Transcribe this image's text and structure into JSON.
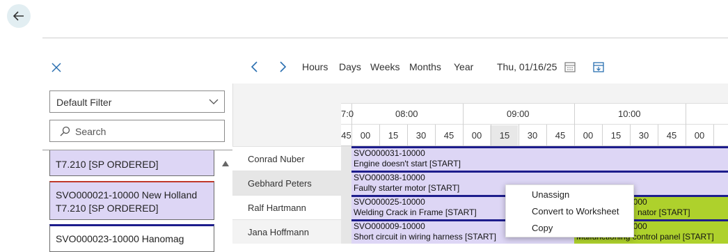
{
  "toolbar": {
    "nav": [
      "Hours",
      "Days",
      "Weeks",
      "Months",
      "Year"
    ],
    "date": "Thu, 01/16/25"
  },
  "filter": {
    "value": "Default Filter"
  },
  "search": {
    "placeholder": "Search"
  },
  "cards": [
    {
      "line1": "T7.210 [SP ORDERED]"
    },
    {
      "line1": "SVO000021-10000 New Holland",
      "line2": "T7.210 [SP ORDERED]"
    },
    {
      "line1": "SVO000023-10000 Hanomag"
    }
  ],
  "resources": [
    "Conrad Nuber",
    "Gebhard Peters",
    "Ralf Hartmann",
    "Jana Hoffmann"
  ],
  "timeline": {
    "partial_hour": "7:0",
    "partial_min": "45",
    "hours": [
      "08:00",
      "09:00",
      "10:00"
    ],
    "minutes": [
      "00",
      "15",
      "30",
      "45",
      "00",
      "15",
      "30",
      "45",
      "00",
      "15",
      "30",
      "45",
      "00"
    ]
  },
  "bars": [
    {
      "id": "SVO000031-10000",
      "desc": "Engine doesn't start [START]"
    },
    {
      "id": "SVO000038-10000",
      "desc": "Faulty starter motor [START]"
    },
    {
      "id": "SVO000025-10000",
      "desc": "Welding Crack in Frame [START]"
    },
    {
      "id": "SVO000009-10000",
      "desc": "Short circuit in wiring harness [START]"
    }
  ],
  "bars_green": [
    {
      "id": "0000",
      "desc": "nator [START]"
    },
    {
      "id": "0000",
      "desc": "Malfunctioning control panel [START]"
    }
  ],
  "context_menu": [
    "Unassign",
    "Convert to Worksheet",
    "Copy"
  ],
  "colors": {
    "bar": "#ddd6f5",
    "bar_border": "#1d1d8c",
    "bar_green": "#aed12c",
    "back_bg": "#e2eef2"
  }
}
